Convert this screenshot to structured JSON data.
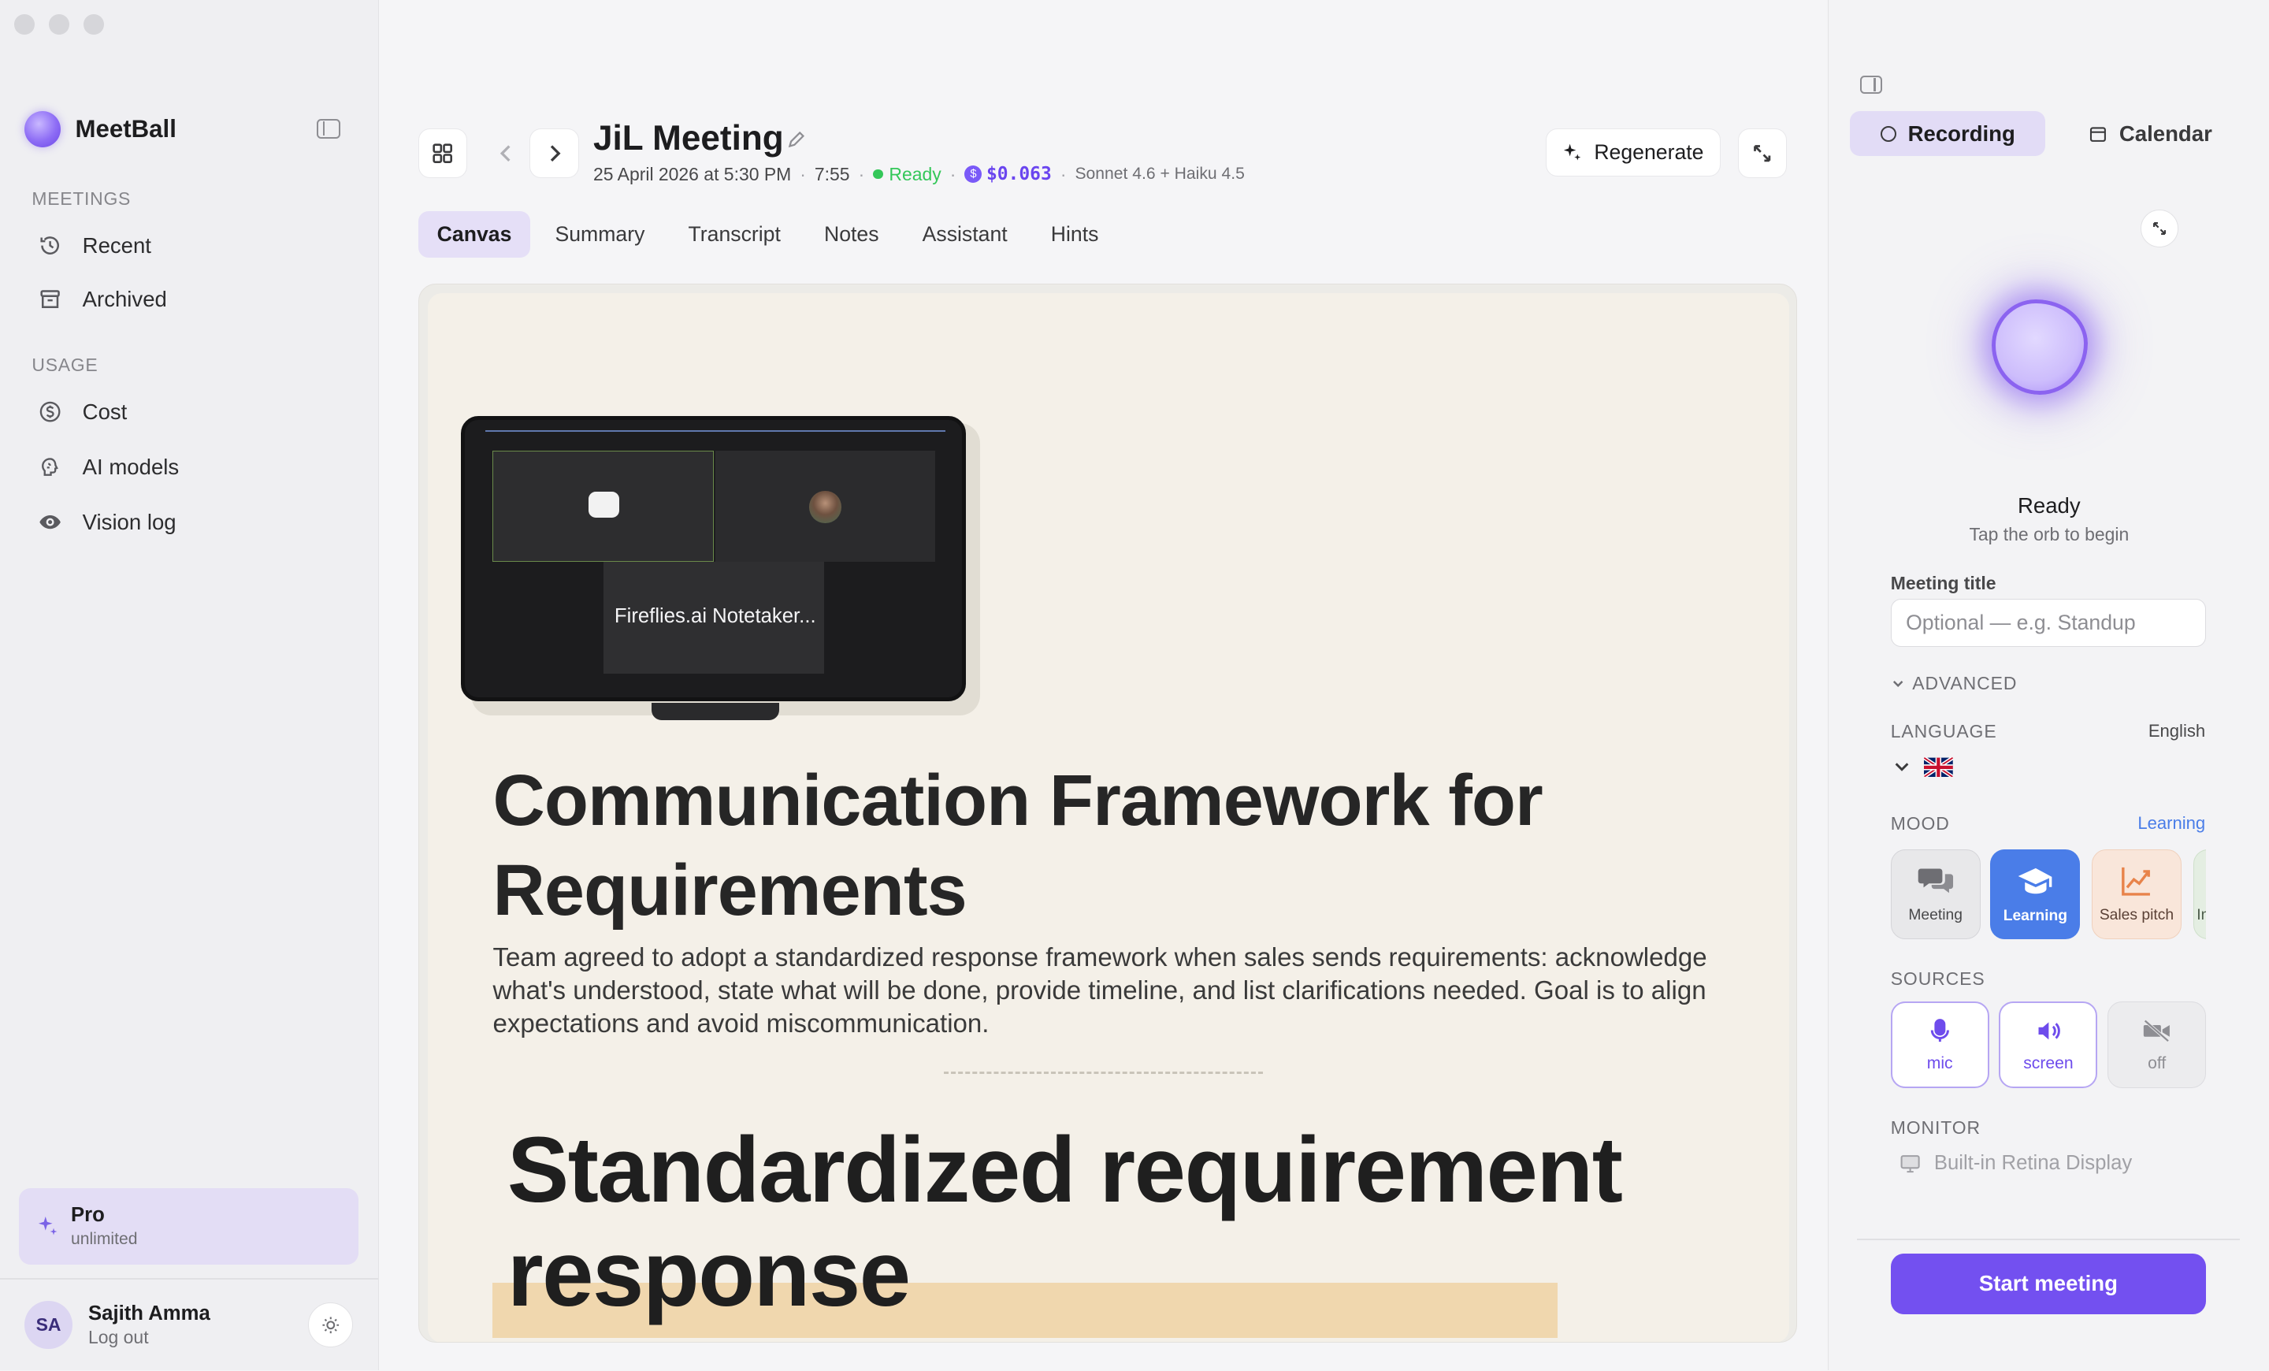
{
  "sidebar": {
    "brand": "MeetBall",
    "sections": {
      "meetings": "MEETINGS",
      "usage": "USAGE"
    },
    "items": {
      "recent": "Recent",
      "archived": "Archived",
      "cost": "Cost",
      "ai_models": "AI models",
      "vision_log": "Vision log"
    },
    "plan": {
      "title": "Pro",
      "subtitle": "unlimited"
    },
    "user": {
      "initials": "SA",
      "name": "Sajith Amma",
      "logout": "Log out"
    }
  },
  "header": {
    "title": "JiL Meeting",
    "date": "25 April 2026 at 5:30 PM",
    "duration": "7:55",
    "status": "Ready",
    "cost": "$0.063",
    "models": "Sonnet 4.6 + Haiku 4.5",
    "regenerate_label": "Regenerate"
  },
  "tabs": [
    "Canvas",
    "Summary",
    "Transcript",
    "Notes",
    "Assistant",
    "Hints"
  ],
  "active_tab": "Canvas",
  "canvas": {
    "thumbnail_caption": "Fireflies.ai Notetaker...",
    "heading_1": "Communication Framework for Requirements",
    "paragraph": "Team agreed to adopt a standardized response framework when sales sends requirements: acknowledge what's understood, state what will be done, provide timeline, and list clarifications needed. Goal is to align expectations and avoid miscommunication.",
    "heading_2": "Standardized requirement response"
  },
  "right_panel": {
    "segments": {
      "recording": "Recording",
      "calendar": "Calendar"
    },
    "status": "Ready",
    "hint": "Tap the orb to begin",
    "meeting_title_label": "Meeting title",
    "meeting_title_placeholder": "Optional — e.g. Standup",
    "meeting_title_value": "",
    "advanced_label": "ADVANCED",
    "language_label": "LANGUAGE",
    "language_value": "English",
    "mood_label": "MOOD",
    "mood_value": "Learning",
    "moods": [
      "Meeting",
      "Learning",
      "Sales pitch",
      "In"
    ],
    "sources_label": "SOURCES",
    "sources": [
      "mic",
      "screen",
      "off"
    ],
    "monitor_label": "MONITOR",
    "monitor_value": "Built-in Retina Display",
    "start_label": "Start meeting"
  },
  "colors": {
    "accent": "#7350f0",
    "accent_soft": "#e2dcf6",
    "ready_green": "#34c759",
    "mood_active": "#4a7de8",
    "canvas_bg": "#f4f0e8",
    "highlight": "#f0d7ae"
  },
  "icons": {
    "recent": "clock-history-icon",
    "archived": "archive-box-icon",
    "cost": "dollar-circle-icon",
    "ai_models": "brain-icon",
    "vision_log": "eye-icon",
    "regenerate": "sparkle-icon",
    "mic": "microphone-icon",
    "screen": "speaker-icon",
    "off": "camera-off-icon",
    "monitor": "display-icon"
  }
}
